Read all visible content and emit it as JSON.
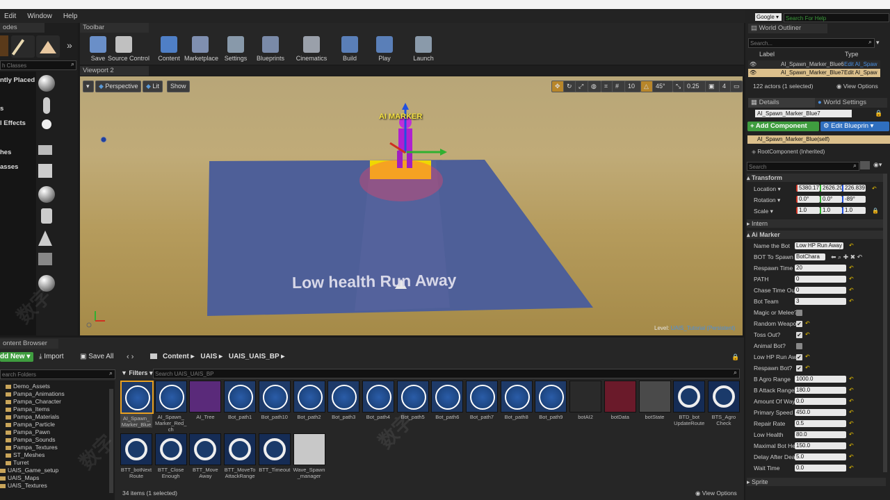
{
  "menu": [
    "Edit",
    "Window",
    "Help"
  ],
  "modes_tab": "odes",
  "place_search_placeholder": "h Classes",
  "place_categories": [
    "ntly Placed",
    "s",
    "l Effects",
    "hes",
    "asses"
  ],
  "toolbar_tab": "Toolbar",
  "toolbar": [
    {
      "label": "Save",
      "color": "#6a8fc8"
    },
    {
      "label": "Source Control",
      "color": "#c0c0c0"
    },
    {
      "label": "Content",
      "color": "#4f7fc6"
    },
    {
      "label": "Marketplace",
      "color": "#7f8fb0"
    },
    {
      "label": "Settings",
      "color": "#8899aa"
    },
    {
      "label": "Blueprints",
      "color": "#7a8aa8"
    },
    {
      "label": "Cinematics",
      "color": "#9aa0aa"
    },
    {
      "label": "Build",
      "color": "#5a7fb8"
    },
    {
      "label": "Play",
      "color": "#5a7fb8"
    },
    {
      "label": "Launch",
      "color": "#8a9aaa"
    }
  ],
  "viewport": {
    "tab": "Viewport 2",
    "perspective": "Perspective",
    "lit": "Lit",
    "show": "Show",
    "grid_value": "10",
    "angle_value": "45°",
    "scale_value": "0.25",
    "camera_speed": "4",
    "marker_label": "AI MARKER",
    "floor_text": "Low health Run Away",
    "level_label": "Level:",
    "level_name": "UAIS_Tutorial (Persistent)"
  },
  "search": {
    "engine": "Google",
    "placeholder": "Search For Help"
  },
  "outliner": {
    "tab": "World Outliner",
    "search_placeholder": "Search...",
    "col_label": "Label",
    "col_type": "Type",
    "rows": [
      {
        "label": "AI_Spawn_Marker_Blue6",
        "type": "Edit AI_Spaw"
      },
      {
        "label": "AI_Spawn_Marker_Blue7",
        "type": "Edit AI_Spaw"
      }
    ],
    "count": "122 actors (1 selected)",
    "view_options": "View Options"
  },
  "details": {
    "tab": "Details",
    "tab2": "World Settings",
    "name_value": "AI_Spawn_Marker_Blue7",
    "add_component": "+ Add Component",
    "edit_blueprint": "Edit Blueprin",
    "component_self": "AI_Spawn_Marker_Blue(self)",
    "root_component": "RootComponent (Inherited)",
    "search_placeholder": "Search",
    "transform_header": "Transform",
    "location_label": "Location",
    "location": [
      "5380.17",
      "2626.20",
      "226.839"
    ],
    "rotation_label": "Rotation",
    "rotation": [
      "0.0°",
      "0.0°",
      "-89°"
    ],
    "scale_label": "Scale",
    "scale": [
      "1.0",
      "1.0",
      "1.0"
    ],
    "intern_header": "Intern",
    "aimarker_header": "Ai Marker",
    "sprite_header": "Sprite",
    "props": [
      {
        "label": "Name the Bot",
        "value": "Low HP Run Away",
        "kind": "text"
      },
      {
        "label": "BOT To Spawn",
        "value": "BotChara",
        "kind": "select"
      },
      {
        "label": "Respawn Time",
        "value": "20",
        "kind": "num"
      },
      {
        "label": "PATH",
        "value": "0",
        "kind": "num"
      },
      {
        "label": "Chase Time Out",
        "value": "0",
        "kind": "num"
      },
      {
        "label": "Bot Team",
        "value": "3",
        "kind": "num"
      },
      {
        "label": "Magic or Melee?",
        "value": "",
        "kind": "chk_off"
      },
      {
        "label": "Random Weapon",
        "value": "",
        "kind": "chk_on"
      },
      {
        "label": "Toss Out?",
        "value": "",
        "kind": "chk_on"
      },
      {
        "label": "Animal Bot?",
        "value": "",
        "kind": "chk_off"
      },
      {
        "label": "Low HP Run Awa",
        "value": "",
        "kind": "chk_on"
      },
      {
        "label": "Respawn Bot?",
        "value": "",
        "kind": "chk_on"
      },
      {
        "label": "B Agro Range",
        "value": "1000.0",
        "kind": "num"
      },
      {
        "label": "B Attack Range",
        "value": "180.0",
        "kind": "num"
      },
      {
        "label": "Amount Of Wayp",
        "value": "0.0",
        "kind": "num"
      },
      {
        "label": "Primary Speed",
        "value": "450.0",
        "kind": "num"
      },
      {
        "label": "Repair Rate",
        "value": "0.5",
        "kind": "num"
      },
      {
        "label": "Low Health",
        "value": "80.0",
        "kind": "num"
      },
      {
        "label": "Maximal Bot He",
        "value": "150.0",
        "kind": "num"
      },
      {
        "label": "Delay After Deat",
        "value": "5.0",
        "kind": "num"
      },
      {
        "label": "Wait Time",
        "value": "0.0",
        "kind": "num"
      }
    ]
  },
  "content_browser": {
    "tab": "ontent Browser",
    "add_new": "dd New",
    "import": "Import",
    "save_all": "Save All",
    "breadcrumb": [
      "Content",
      "UAIS",
      "UAIS_UAIS_BP"
    ],
    "folder_search": "earch Folders",
    "filters": "Filters",
    "asset_search": "Search UAIS_UAIS_BP",
    "folders": [
      "Demo_Assets",
      "Pampa_Animations",
      "Pampa_Character",
      "Pampa_Items",
      "Pampa_Materials",
      "Pampa_Particle",
      "Pampa_Pawn",
      "Pampa_Sounds",
      "Pampa_Textures",
      "ST_Meshes",
      "Turret",
      "UAIS_Game_setup",
      "UAIS_Maps",
      "UAIS_Textures"
    ],
    "assets_row1": [
      {
        "name": "AI_Spawn_\nMarker_Blue",
        "kind": "target"
      },
      {
        "name": "AI_Spawn_\nMarker_Red_\nch",
        "kind": "target"
      },
      {
        "name": "AI_Tree",
        "kind": "tree"
      },
      {
        "name": "Bot_path1",
        "kind": "target"
      },
      {
        "name": "Bot_path10",
        "kind": "target"
      },
      {
        "name": "Bot_path2",
        "kind": "target"
      },
      {
        "name": "Bot_path3",
        "kind": "target"
      },
      {
        "name": "Bot_path4",
        "kind": "target"
      },
      {
        "name": "Bot_path5",
        "kind": "target"
      },
      {
        "name": "Bot_path6",
        "kind": "target"
      },
      {
        "name": "Bot_path7",
        "kind": "target"
      },
      {
        "name": "Bot_path8",
        "kind": "target"
      },
      {
        "name": "Bot_path9",
        "kind": "target"
      },
      {
        "name": "botAI2",
        "kind": "pawn"
      },
      {
        "name": "botData",
        "kind": "board"
      },
      {
        "name": "botState",
        "kind": "doc"
      },
      {
        "name": "BTD_bot\nUpdateRoute",
        "kind": "ring"
      },
      {
        "name": "BTS_Agro\nCheck",
        "kind": "ring"
      }
    ],
    "assets_row2": [
      {
        "name": "BTT_botNext\nRoute",
        "kind": "ring"
      },
      {
        "name": "BTT_Close\nEnough",
        "kind": "ring"
      },
      {
        "name": "BTT_Move\nAway",
        "kind": "ring"
      },
      {
        "name": "BTT_MoveTo\nAttackRange",
        "kind": "ring"
      },
      {
        "name": "BTT_Timeout",
        "kind": "ring"
      },
      {
        "name": "Wave_Spawn\n_manager",
        "kind": "tex"
      }
    ],
    "status": "34 items (1 selected)",
    "view_options": "View Options"
  }
}
